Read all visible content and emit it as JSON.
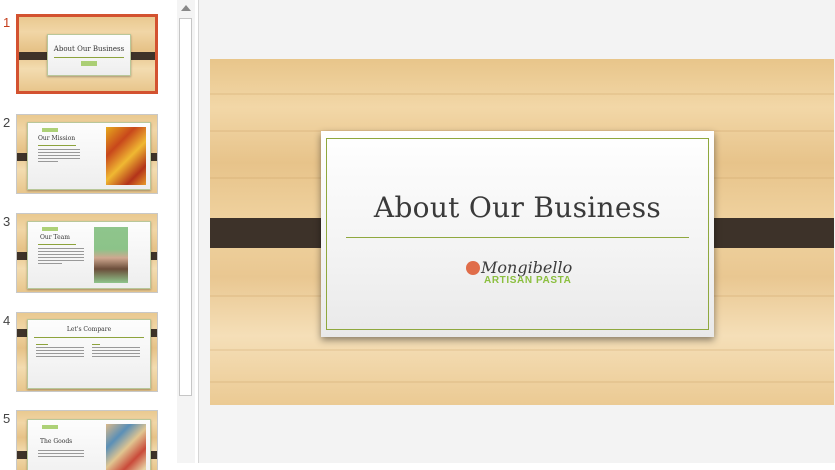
{
  "thumbnails": [
    {
      "number": "1",
      "title": "About Our Business"
    },
    {
      "number": "2",
      "title": "Our Mission"
    },
    {
      "number": "3",
      "title": "Our Team"
    },
    {
      "number": "4",
      "title": "Let's Compare"
    },
    {
      "number": "5",
      "title": "The Goods"
    }
  ],
  "slide": {
    "title": "About Our Business",
    "logo_name": "Mongibello",
    "logo_tagline": "ARTISAN PASTA"
  },
  "colors": {
    "accent_active": "#d35230",
    "band": "#3d3229",
    "rule": "#8fa83e",
    "logo_green": "#8bbf3f",
    "logo_icon": "#e06d4a"
  }
}
